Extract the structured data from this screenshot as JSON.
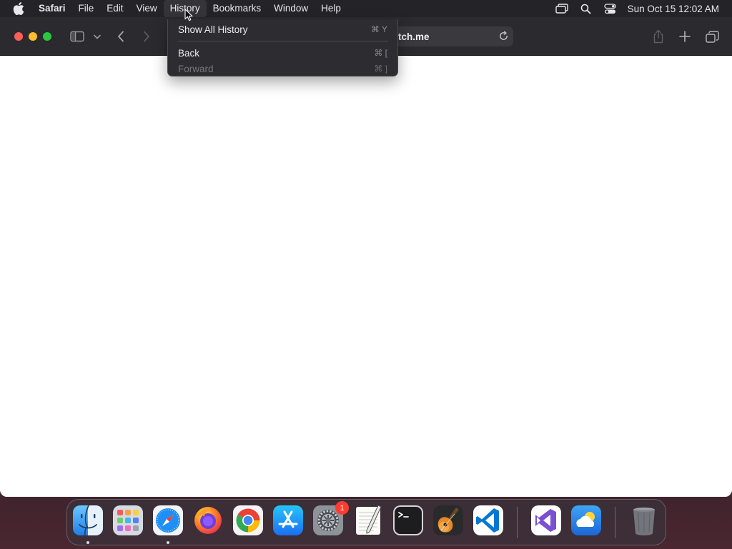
{
  "menubar": {
    "app_name": "Safari",
    "items": [
      "File",
      "Edit",
      "View",
      "History",
      "Bookmarks",
      "Window",
      "Help"
    ],
    "status_icons": [
      "screen-mirroring-icon",
      "spotlight-search-icon",
      "control-center-icon"
    ],
    "clock": "Sun Oct 15  12:02 AM"
  },
  "toolbar": {
    "address_text": "tch.me"
  },
  "history_menu": {
    "items": [
      {
        "label": "Show All History",
        "shortcut": "⌘ Y",
        "enabled": true
      },
      {
        "label": "Back",
        "shortcut": "⌘ [",
        "enabled": true
      },
      {
        "label": "Forward",
        "shortcut": "⌘ ]",
        "enabled": false
      }
    ]
  },
  "dock": {
    "apps": [
      {
        "name": "finder-icon",
        "running": true
      },
      {
        "name": "launchpad-icon",
        "running": false
      },
      {
        "name": "safari-icon",
        "running": true
      },
      {
        "name": "firefox-icon",
        "running": false
      },
      {
        "name": "chrome-icon",
        "running": false
      },
      {
        "name": "app-store-icon",
        "running": false
      },
      {
        "name": "system-settings-icon",
        "running": false,
        "badge": "1"
      },
      {
        "name": "textedit-icon",
        "running": false
      },
      {
        "name": "terminal-icon",
        "running": false
      },
      {
        "name": "garageband-icon",
        "running": false
      },
      {
        "name": "vscode-icon",
        "running": false
      },
      {
        "name": "visual-studio-icon",
        "running": false
      },
      {
        "name": "weather-icon",
        "running": false
      },
      {
        "name": "trash-icon",
        "running": false
      }
    ]
  },
  "colors": {
    "close": "#fe5f57",
    "minimize": "#febc2e",
    "zoom": "#28c840",
    "menu_bg": "#2d2c31",
    "toolbar_bg": "#2b2a2f"
  }
}
